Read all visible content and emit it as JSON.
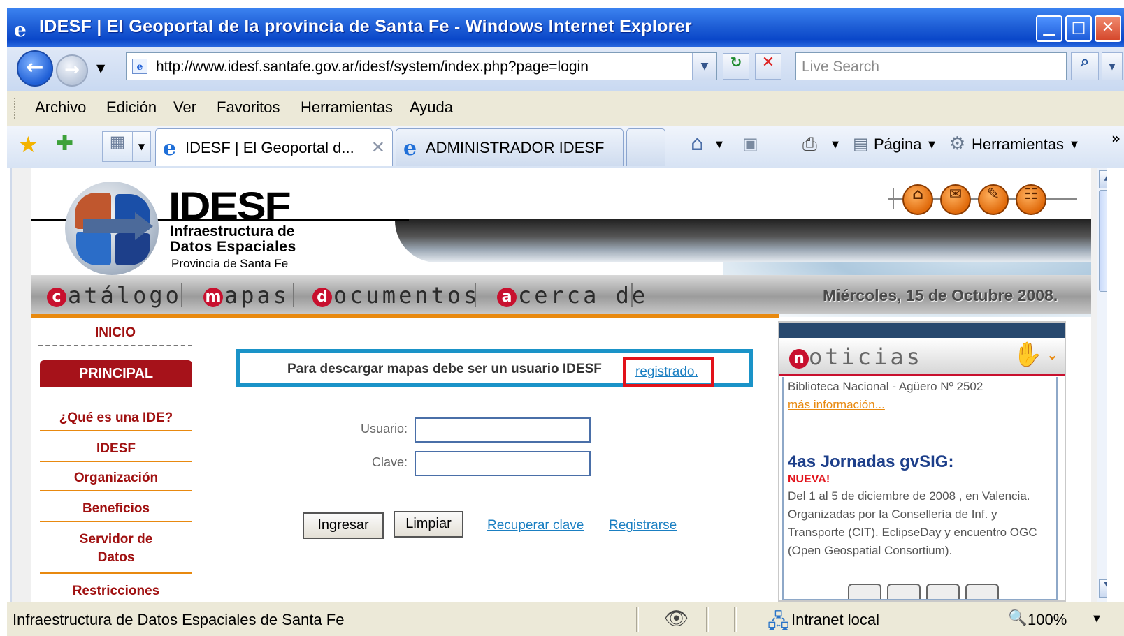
{
  "window": {
    "title": "IDESF | El Geoportal de la provincia de Santa Fe - Windows Internet Explorer",
    "min_glyph": "▁",
    "max_glyph": "□",
    "close_glyph": "✕"
  },
  "navbar": {
    "url": "http://www.idesf.santafe.gov.ar/idesf/system/index.php?page=login",
    "search_placeholder": "Live Search"
  },
  "menu": [
    "Archivo",
    "Edición",
    "Ver",
    "Favoritos",
    "Herramientas",
    "Ayuda"
  ],
  "tabs": [
    {
      "label": "IDESF | El Geoportal d...",
      "active": true
    },
    {
      "label": "ADMINISTRADOR IDESF",
      "active": false
    }
  ],
  "commandbar": {
    "page_label": "Página",
    "tools_label": "Herramientas"
  },
  "site": {
    "brand": "IDESF",
    "subtitle_line1": "Infraestructura de",
    "subtitle_line2": "Datos Espaciales",
    "subtitle_line3": "Provincia de Santa Fe",
    "nav": [
      {
        "cap": "c",
        "rest": "atálogo"
      },
      {
        "cap": "m",
        "rest": "apas"
      },
      {
        "cap": "d",
        "rest": "ocumentos"
      },
      {
        "cap": "a",
        "rest": "cerca de"
      }
    ],
    "date": "Miércoles, 15 de Octubre 2008.",
    "top_icons": [
      "home-icon",
      "mail-icon",
      "edit-icon",
      "sitemap-icon"
    ]
  },
  "sidebar": {
    "inicio": "INICIO",
    "principal": "PRINCIPAL",
    "items": [
      "¿Qué es una IDE?",
      "IDESF",
      "Organización",
      "Beneficios",
      "Servidor de Datos",
      "Restricciones"
    ]
  },
  "login": {
    "notice_text": "Para descargar mapas debe ser un usuario IDESF",
    "notice_link": "registrado.",
    "user_label": "Usuario:",
    "user_value": "",
    "password_label": "Clave:",
    "password_value": "",
    "submit_label": "Ingresar",
    "clear_label": "Limpiar",
    "recover_link": "Recuperar clave",
    "register_link": "Registrarse"
  },
  "news": {
    "cap": "n",
    "title_rest": "oticias",
    "item1_text": "Biblioteca Nacional - Agüero Nº 2502",
    "item1_link": "más información...",
    "item2_title": "4as Jornadas gvSIG:",
    "item2_badge": "NUEVA!",
    "item2_text": "Del 1 al 5 de diciembre de 2008 , en Valencia. Organizadas por la Consellería de Inf. y Transporte (CIT). EclipseDay y encuentro OGC (Open Geospatial Consortium)."
  },
  "status": {
    "text": "Infraestructura de Datos Espaciales de Santa Fe",
    "zone": "Intranet local",
    "zoom": "100%"
  }
}
